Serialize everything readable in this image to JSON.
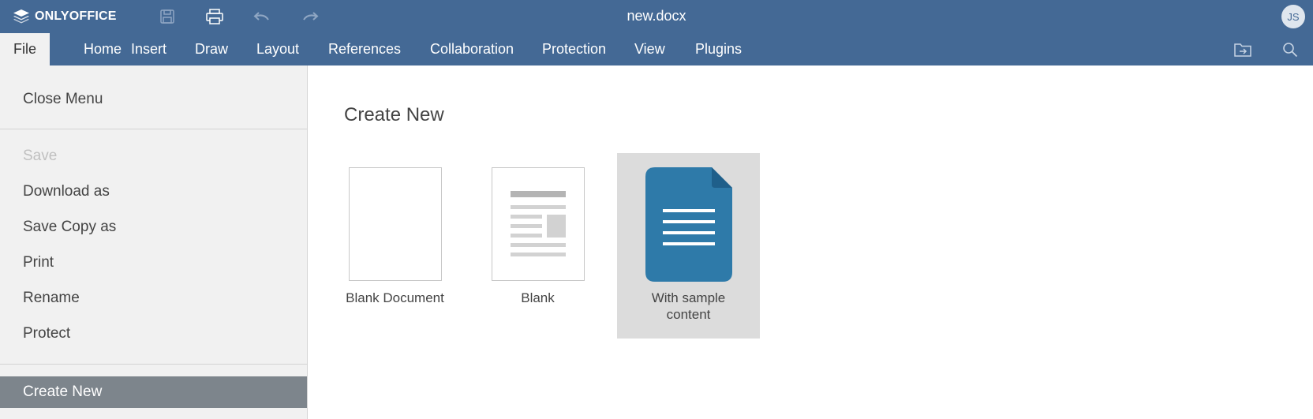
{
  "app": {
    "brand": "ONLYOFFICE",
    "doc_title": "new.docx",
    "user_initials": "JS"
  },
  "quick_access": {
    "icons": [
      "save-icon",
      "print-icon",
      "undo-icon",
      "redo-icon"
    ]
  },
  "tabs": [
    {
      "label": "File",
      "active": true
    },
    {
      "label": "Home"
    },
    {
      "label": "Insert"
    },
    {
      "label": "Draw"
    },
    {
      "label": "Layout"
    },
    {
      "label": "References"
    },
    {
      "label": "Collaboration"
    },
    {
      "label": "Protection"
    },
    {
      "label": "View"
    },
    {
      "label": "Plugins"
    }
  ],
  "file_menu": {
    "close": "Close Menu",
    "items": [
      {
        "label": "Save",
        "disabled": true
      },
      {
        "label": "Download as"
      },
      {
        "label": "Save Copy as"
      },
      {
        "label": "Print"
      },
      {
        "label": "Rename"
      },
      {
        "label": "Protect"
      }
    ],
    "selected": "Create New"
  },
  "create_new": {
    "heading": "Create New",
    "templates": [
      {
        "label": "Blank Document",
        "icon": "blank-page-icon"
      },
      {
        "label": "Blank",
        "icon": "layout-page-icon"
      },
      {
        "label": "With sample content",
        "icon": "document-icon",
        "hover": true
      }
    ]
  },
  "colors": {
    "header": "#446995",
    "sidebar": "#f1f1f1",
    "selected_item": "#7d858c",
    "document_icon": "#2e7aa9"
  }
}
